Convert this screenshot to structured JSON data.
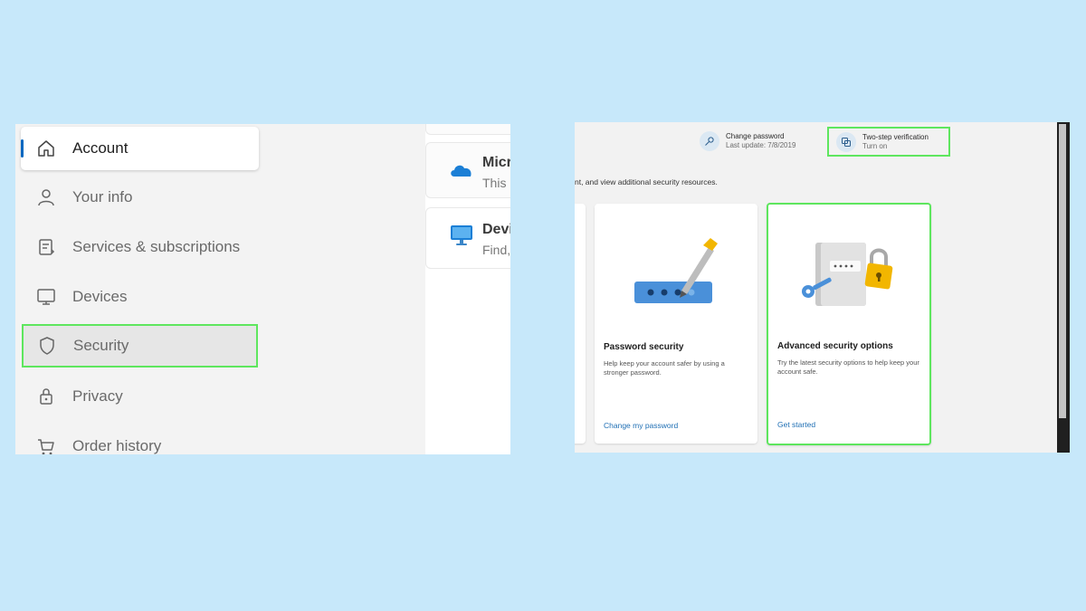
{
  "left": {
    "nav": [
      {
        "label": "Account",
        "icon": "home-icon"
      },
      {
        "label": "Your info",
        "icon": "person-icon"
      },
      {
        "label": "Services & subscriptions",
        "icon": "receipt-icon"
      },
      {
        "label": "Devices",
        "icon": "monitor-icon"
      },
      {
        "label": "Security",
        "icon": "shield-icon"
      },
      {
        "label": "Privacy",
        "icon": "lock-icon"
      },
      {
        "label": "Order history",
        "icon": "cart-icon"
      }
    ],
    "cards": [
      {
        "title": "Micr",
        "sub": "This i",
        "icon": "cloud-icon"
      },
      {
        "title": "Devi",
        "sub": "Find,",
        "icon": "monitor-icon"
      }
    ]
  },
  "right": {
    "change_password": {
      "title": "Change password",
      "sub": "Last update: 7/8/2019"
    },
    "two_step": {
      "title": "Two-step verification",
      "sub": "Turn on"
    },
    "intro": "nt, and view additional security resources.",
    "cards": [
      {
        "title": "Password security",
        "desc": "Help keep your account safer by using a stronger password.",
        "link": "Change my password"
      },
      {
        "title": "Advanced security options",
        "desc": "Try the latest security options to help keep your account safe.",
        "link": "Get started"
      }
    ]
  },
  "colors": {
    "background": "#c7e8fa",
    "highlight": "#5ee65e",
    "accent": "#0067c0",
    "link": "#1f6fb4"
  }
}
